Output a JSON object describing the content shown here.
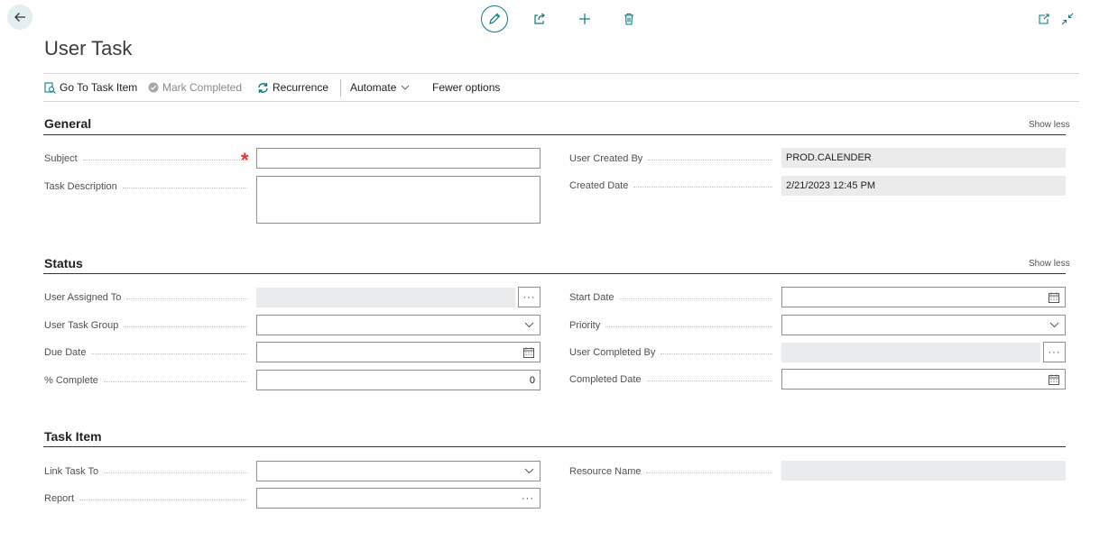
{
  "page": {
    "title": "User Task"
  },
  "actions": {
    "go_to_task_item": "Go To Task Item",
    "mark_completed": "Mark Completed",
    "recurrence": "Recurrence",
    "automate": "Automate",
    "fewer_options": "Fewer options"
  },
  "sections": {
    "general": {
      "title": "General",
      "show_less": "Show less",
      "subject": {
        "label": "Subject",
        "value": ""
      },
      "task_description": {
        "label": "Task Description",
        "value": ""
      },
      "user_created_by": {
        "label": "User Created By",
        "value": "PROD.CALENDER"
      },
      "created_date": {
        "label": "Created Date",
        "value": "2/21/2023 12:45 PM"
      }
    },
    "status": {
      "title": "Status",
      "show_less": "Show less",
      "user_assigned_to": {
        "label": "User Assigned To",
        "value": ""
      },
      "user_task_group": {
        "label": "User Task Group",
        "value": ""
      },
      "due_date": {
        "label": "Due Date",
        "value": ""
      },
      "percent_complete": {
        "label": "% Complete",
        "value": "0"
      },
      "start_date": {
        "label": "Start Date",
        "value": ""
      },
      "priority": {
        "label": "Priority",
        "value": ""
      },
      "user_completed_by": {
        "label": "User Completed By",
        "value": ""
      },
      "completed_date": {
        "label": "Completed Date",
        "value": ""
      }
    },
    "task_item": {
      "title": "Task Item",
      "link_task_to": {
        "label": "Link Task To",
        "value": ""
      },
      "report": {
        "label": "Report",
        "value": ""
      },
      "resource_name": {
        "label": "Resource Name",
        "value": ""
      }
    }
  },
  "colors": {
    "accent": "#0e7a83",
    "required": "#e0352b",
    "readonly_bg": "#eaebec",
    "back_bg": "#e3eef1"
  },
  "icons": [
    "back-arrow-icon",
    "edit-icon",
    "share-icon",
    "plus-icon",
    "delete-icon",
    "open-new-window-icon",
    "collapse-icon",
    "search-task-icon",
    "check-circle-icon",
    "recurrence-icon",
    "chevron-down-icon",
    "calendar-icon",
    "ellipsis-icon"
  ]
}
